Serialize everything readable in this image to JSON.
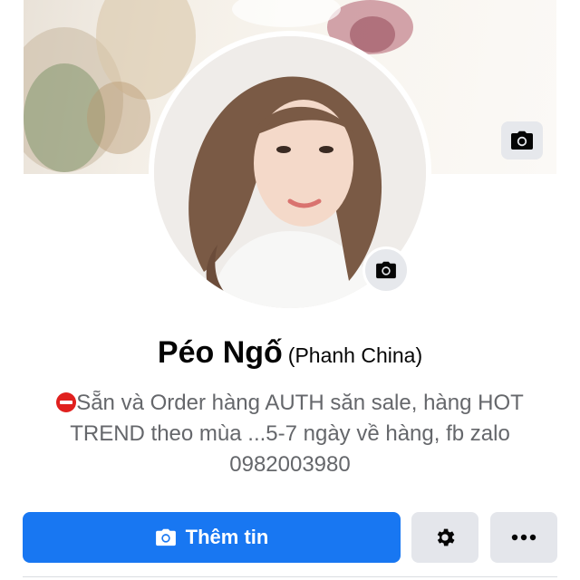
{
  "profile": {
    "name": "Péo Ngố",
    "alternate_name": "(Phanh China)",
    "bio": "Sẵn và Order hàng AUTH săn sale, hàng HOT TREND theo mùa ...5-7 ngày về hàng, fb zalo 0982003980",
    "bio_icon": "no-entry-icon"
  },
  "actions": {
    "add_info_label": "Thêm tin",
    "add_info_icon": "camera-icon",
    "settings_icon": "gear-icon",
    "more_icon": "more-horizontal-icon"
  },
  "colors": {
    "primary": "#1877f2",
    "secondary_button": "#e4e6eb",
    "bio_text": "#65676b",
    "name_text": "#050505"
  }
}
